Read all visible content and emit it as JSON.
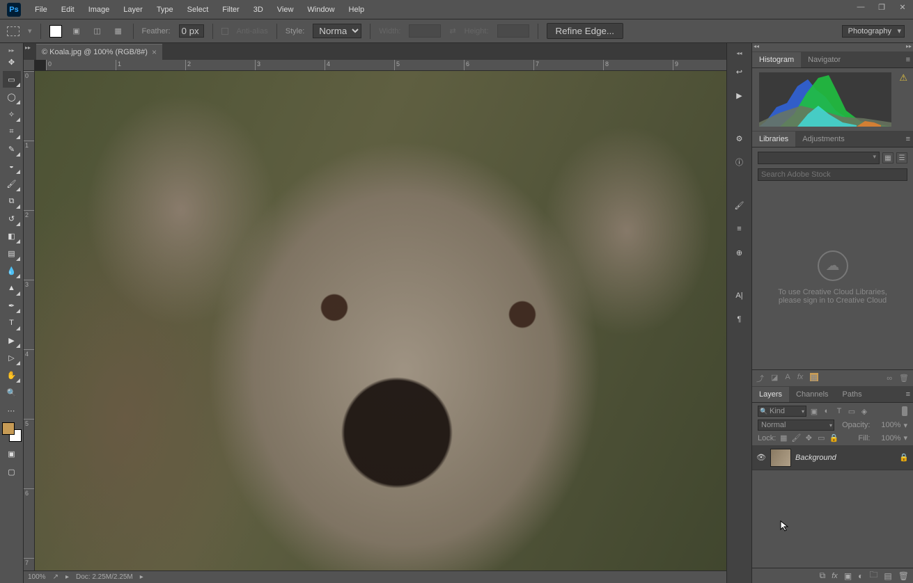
{
  "app": {
    "logo_text": "Ps"
  },
  "menubar": [
    "File",
    "Edit",
    "Image",
    "Layer",
    "Type",
    "Select",
    "Filter",
    "3D",
    "View",
    "Window",
    "Help"
  ],
  "window_controls": {
    "min": "—",
    "max": "❐",
    "close": "✕"
  },
  "options_bar": {
    "feather_label": "Feather:",
    "feather_value": "0 px",
    "anti_alias_label": "Anti-alias",
    "style_label": "Style:",
    "style_value": "Normal",
    "width_label": "Width:",
    "height_label": "Height:",
    "refine_label": "Refine Edge...",
    "workspace": "Photography"
  },
  "document": {
    "tab_title": "© Koala.jpg @ 100% (RGB/8#)",
    "zoom": "100%",
    "status": "Doc: 2.25M/2.25M"
  },
  "ruler": {
    "h": [
      "0",
      "1",
      "2",
      "3",
      "4",
      "5",
      "6",
      "7",
      "8",
      "9"
    ],
    "v": [
      "0",
      "1",
      "2",
      "3",
      "4",
      "5",
      "6",
      "7"
    ]
  },
  "tools": [
    {
      "name": "move",
      "glyph": "✥",
      "corner": false
    },
    {
      "name": "rectangular-marquee",
      "glyph": "▭",
      "corner": true,
      "selected": true
    },
    {
      "name": "lasso",
      "glyph": "◯",
      "corner": true
    },
    {
      "name": "quick-selection",
      "glyph": "✧",
      "corner": true
    },
    {
      "name": "crop",
      "glyph": "⌗",
      "corner": true
    },
    {
      "name": "eyedropper",
      "glyph": "✎",
      "corner": true
    },
    {
      "name": "spot-healing",
      "glyph": "◒",
      "corner": true
    },
    {
      "name": "brush",
      "glyph": "🖌",
      "corner": true
    },
    {
      "name": "clone-stamp",
      "glyph": "⧉",
      "corner": true
    },
    {
      "name": "history-brush",
      "glyph": "↺",
      "corner": true
    },
    {
      "name": "eraser",
      "glyph": "◧",
      "corner": true
    },
    {
      "name": "gradient",
      "glyph": "▤",
      "corner": true
    },
    {
      "name": "blur",
      "glyph": "💧",
      "corner": true
    },
    {
      "name": "dodge",
      "glyph": "▲",
      "corner": true
    },
    {
      "name": "pen",
      "glyph": "✒",
      "corner": true
    },
    {
      "name": "type",
      "glyph": "T",
      "corner": true
    },
    {
      "name": "path-selection",
      "glyph": "▶",
      "corner": true
    },
    {
      "name": "direct-selection",
      "glyph": "▷",
      "corner": true
    },
    {
      "name": "hand",
      "glyph": "✋",
      "corner": true
    },
    {
      "name": "zoom",
      "glyph": "🔍",
      "corner": false
    }
  ],
  "toolbar_extra": {
    "more": "⋯",
    "quickmask": "▣",
    "screenmode": "▢"
  },
  "collapsed_panels": [
    {
      "name": "history",
      "glyph": "↩"
    },
    {
      "name": "actions",
      "glyph": "▶"
    },
    {
      "name": "properties",
      "glyph": "⚙"
    },
    {
      "name": "info",
      "glyph": "ⓘ"
    },
    {
      "name": "brushes",
      "glyph": "🖌"
    },
    {
      "name": "brush-presets",
      "glyph": "≡"
    },
    {
      "name": "clone-source",
      "glyph": "⊕"
    },
    {
      "name": "character",
      "glyph": "A|"
    },
    {
      "name": "paragraph",
      "glyph": "¶"
    }
  ],
  "panel_tabs": {
    "row1": [
      {
        "label": "Histogram",
        "active": true
      },
      {
        "label": "Navigator",
        "active": false
      }
    ],
    "row2": [
      {
        "label": "Libraries",
        "active": true
      },
      {
        "label": "Adjustments",
        "active": false
      }
    ],
    "row3": [
      {
        "label": "Layers",
        "active": true
      },
      {
        "label": "Channels",
        "active": false
      },
      {
        "label": "Paths",
        "active": false
      }
    ]
  },
  "libraries": {
    "search_placeholder": "Search Adobe Stock",
    "cc_line1": "To use Creative Cloud Libraries,",
    "cc_line2": "please sign in to Creative Cloud",
    "footer_icons": {
      "upload": "⤴",
      "graphic": "◪",
      "char": "A",
      "fx": "fx",
      "swatch": "▦",
      "link": "∞",
      "trash": "🗑"
    }
  },
  "layers": {
    "kind": "Kind",
    "filter_icons": {
      "image": "▣",
      "adjust": "◐",
      "type": "T",
      "shape": "▭",
      "smart": "◈"
    },
    "blend_mode": "Normal",
    "opacity_label": "Opacity:",
    "opacity_value": "100%",
    "lock_label": "Lock:",
    "lock_icons": {
      "trans": "▦",
      "pixels": "🖌",
      "position": "✥",
      "artboard": "▭",
      "all": "🔒"
    },
    "fill_label": "Fill:",
    "fill_value": "100%",
    "items": [
      {
        "name": "Background",
        "visible": true,
        "locked": true
      }
    ],
    "footer_icons": {
      "link": "⧉",
      "fx": "fx",
      "mask": "▣",
      "fill": "◐",
      "group": "🗀",
      "new": "▤",
      "trash": "🗑"
    }
  },
  "histogram_warn": "⚠"
}
